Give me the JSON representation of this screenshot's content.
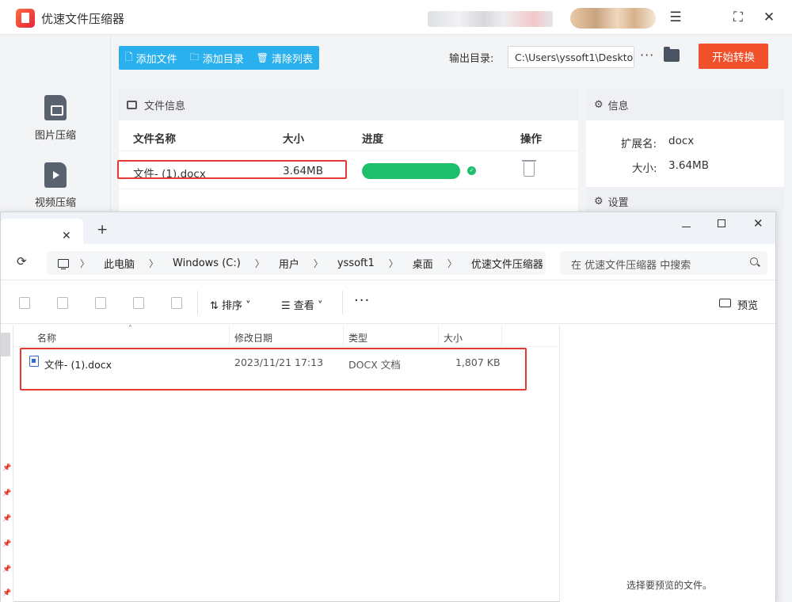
{
  "app": {
    "title": "优速文件压缩器",
    "sidebar": [
      {
        "label": "图片压缩",
        "icon": "image-file-icon"
      },
      {
        "label": "视频压缩",
        "icon": "video-file-icon"
      }
    ],
    "toolbar": {
      "add_file": "添加文件",
      "add_folder": "添加目录",
      "clear_list": "清除列表"
    },
    "output": {
      "label": "输出目录:",
      "path": "C:\\Users\\yssoft1\\Deskto",
      "more": "···",
      "start_button": "开始转换"
    },
    "file_panel": {
      "header": "文件信息",
      "columns": [
        "文件名称",
        "大小",
        "进度",
        "操作"
      ],
      "rows": [
        {
          "name": "文件- (1).docx",
          "size": "3.64MB",
          "progress": 1.0,
          "status": "done"
        }
      ]
    },
    "info_panel": {
      "header": "信息",
      "ext_label": "扩展名:",
      "ext_value": "docx",
      "size_label": "大小:",
      "size_value": "3.64MB",
      "settings_header": "设置"
    }
  },
  "explorer": {
    "tab_close": "✕",
    "tab_add": "+",
    "breadcrumb": [
      "此电脑",
      "Windows (C:)",
      "用户",
      "yssoft1",
      "桌面",
      "优速文件压缩器"
    ],
    "search_placeholder": "在 优速文件压缩器 中搜索",
    "commands": {
      "sort": "排序",
      "view": "查看",
      "more": "···",
      "preview": "预览"
    },
    "columns": [
      "名称",
      "修改日期",
      "类型",
      "大小"
    ],
    "files": [
      {
        "name": "文件- (1).docx",
        "modified": "2023/11/21 17:13",
        "type": "DOCX 文档",
        "size": "1,807 KB"
      }
    ],
    "preview_message": "选择要预览的文件。"
  },
  "colors": {
    "accent_blue": "#2bb0ee",
    "start_orange": "#f0502a",
    "progress_green": "#1fbf6e",
    "highlight_red": "#e53935"
  }
}
